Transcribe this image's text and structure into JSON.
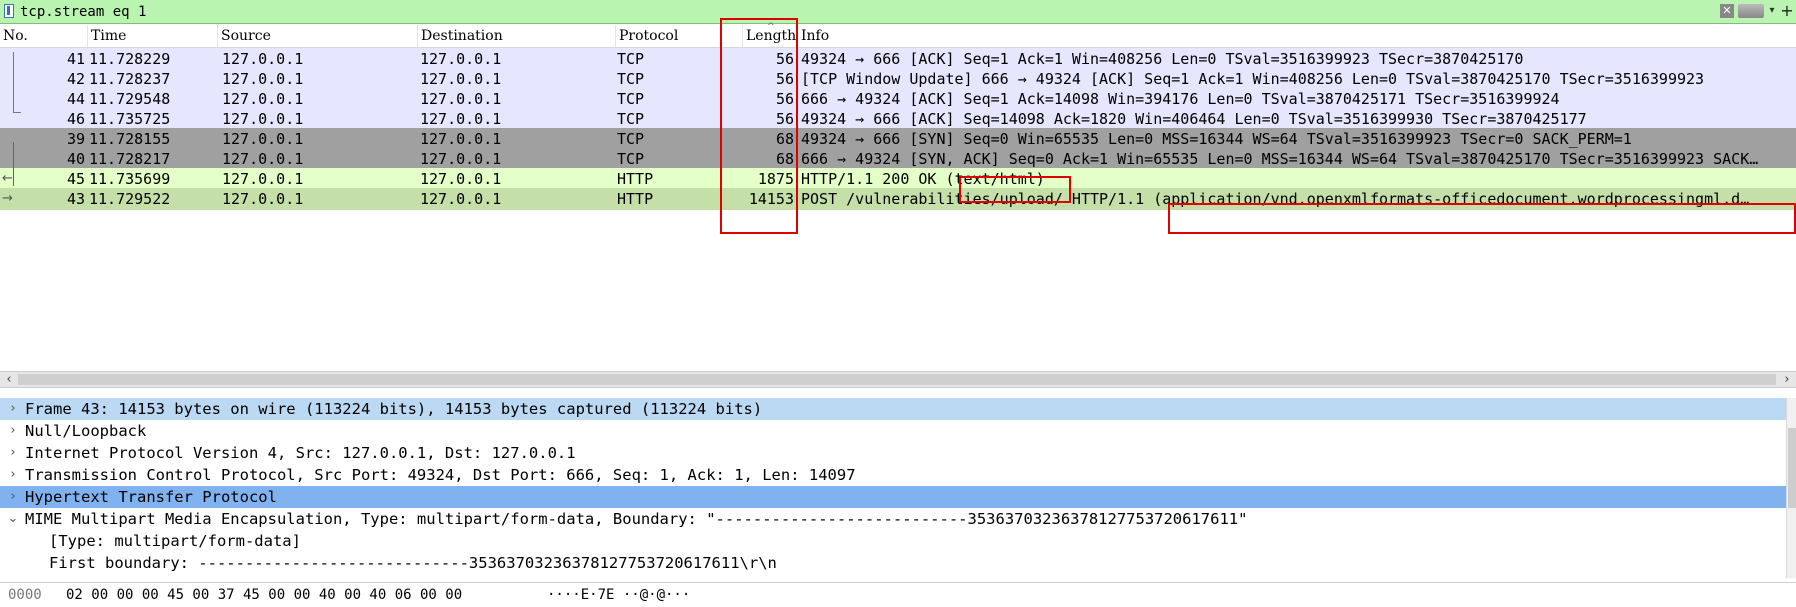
{
  "filter": {
    "value": "tcp.stream eq 1",
    "clear_icon": "close-icon",
    "apply_icon": "apply-arrow-icon",
    "dropdown_icon": "chevron-down-icon",
    "add_icon": "plus-icon"
  },
  "columns": [
    "No.",
    "Time",
    "Source",
    "Destination",
    "Protocol",
    "Length",
    "Info"
  ],
  "packets": [
    {
      "no": "41",
      "time": "11.728229",
      "src": "127.0.0.1",
      "dst": "127.0.0.1",
      "proto": "TCP",
      "len": "56",
      "info": "49324 → 666 [ACK] Seq=1 Ack=1 Win=408256 Len=0 TSval=3516399923 TSecr=3870425170",
      "style": "tcp-light"
    },
    {
      "no": "42",
      "time": "11.728237",
      "src": "127.0.0.1",
      "dst": "127.0.0.1",
      "proto": "TCP",
      "len": "56",
      "info": "[TCP Window Update] 666 → 49324 [ACK] Seq=1 Ack=1 Win=408256 Len=0 TSval=3870425170 TSecr=3516399923",
      "style": "tcp-light"
    },
    {
      "no": "44",
      "time": "11.729548",
      "src": "127.0.0.1",
      "dst": "127.0.0.1",
      "proto": "TCP",
      "len": "56",
      "info": "666 → 49324 [ACK] Seq=1 Ack=14098 Win=394176 Len=0 TSval=3870425171 TSecr=3516399924",
      "style": "tcp-light"
    },
    {
      "no": "46",
      "time": "11.735725",
      "src": "127.0.0.1",
      "dst": "127.0.0.1",
      "proto": "TCP",
      "len": "56",
      "info": "49324 → 666 [ACK] Seq=14098 Ack=1820 Win=406464 Len=0 TSval=3516399930 TSecr=3870425177",
      "style": "tcp-light"
    },
    {
      "no": "39",
      "time": "11.728155",
      "src": "127.0.0.1",
      "dst": "127.0.0.1",
      "proto": "TCP",
      "len": "68",
      "info": "49324 → 666 [SYN] Seq=0 Win=65535 Len=0 MSS=16344 WS=64 TSval=3516399923 TSecr=0 SACK_PERM=1",
      "style": "tcp-dark"
    },
    {
      "no": "40",
      "time": "11.728217",
      "src": "127.0.0.1",
      "dst": "127.0.0.1",
      "proto": "TCP",
      "len": "68",
      "info": "666 → 49324 [SYN, ACK] Seq=0 Ack=1 Win=65535 Len=0 MSS=16344 WS=64 TSval=3870425170 TSecr=3516399923 SACK…",
      "style": "tcp-dark"
    },
    {
      "no": "45",
      "time": "11.735699",
      "src": "127.0.0.1",
      "dst": "127.0.0.1",
      "proto": "HTTP",
      "len": "1875",
      "info": "HTTP/1.1 200 OK  (text/html)",
      "style": "http-light"
    },
    {
      "no": "43",
      "time": "11.729522",
      "src": "127.0.0.1",
      "dst": "127.0.0.1",
      "proto": "HTTP",
      "len": "14153",
      "info": "POST /vulnerabilities/upload/ HTTP/1.1  (application/vnd.openxmlformats-officedocument.wordprocessingml.d…",
      "style": "http-sel"
    }
  ],
  "details": [
    {
      "text": "Frame 43: 14153 bytes on wire (113224 bits), 14153 bytes captured (113224 bits)",
      "expander": ">",
      "style": "sel-light"
    },
    {
      "text": "Null/Loopback",
      "expander": ">",
      "style": ""
    },
    {
      "text": "Internet Protocol Version 4, Src: 127.0.0.1, Dst: 127.0.0.1",
      "expander": ">",
      "style": ""
    },
    {
      "text": "Transmission Control Protocol, Src Port: 49324, Dst Port: 666, Seq: 1, Ack: 1, Len: 14097",
      "expander": ">",
      "style": ""
    },
    {
      "text": "Hypertext Transfer Protocol",
      "expander": ">",
      "style": "sel"
    },
    {
      "text": "MIME Multipart Media Encapsulation, Type: multipart/form-data, Boundary: \"---------------------------353637032363781277537206176​11\"",
      "expander": "v",
      "style": ""
    },
    {
      "text": "[Type: multipart/form-data]",
      "expander": "",
      "style": "child"
    },
    {
      "text": "First boundary: -----------------------------353637032363781277537206176​11\\r\\n",
      "expander": "",
      "style": "child"
    }
  ],
  "bytes": {
    "offset": "0000",
    "hex": "02 00 00 00 45 00 37 45  00 00 40 00 40 06 00 00",
    "ascii": "····E·7E ··@·@···"
  }
}
